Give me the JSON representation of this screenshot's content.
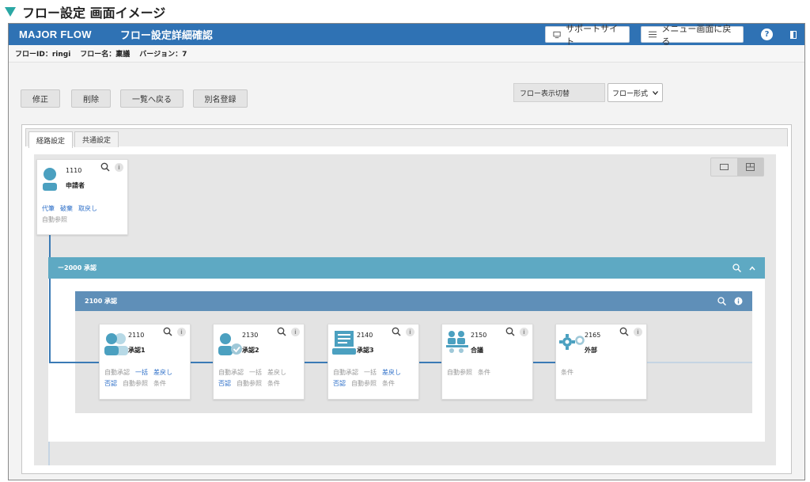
{
  "caption": "フロー設定 画面イメージ",
  "header": {
    "logo": "MAJOR FLOW",
    "title": "フロー設定詳細確認",
    "support_label": "サポートサイト",
    "menu_label": "メニュー画面に戻る"
  },
  "info": {
    "flow_id": "フローID：ringi",
    "flow_name": "フロー名：稟議",
    "version": "バージョン：7"
  },
  "actions": {
    "edit": "修正",
    "delete": "削除",
    "back": "一覧へ戻る",
    "alias": "別名登録",
    "display_switch": "フロー表示切替",
    "display_mode": "フロー形式"
  },
  "tabs": [
    "経路設定",
    "共通設定"
  ],
  "applicant": {
    "num": "1110",
    "name": "申請者",
    "links": [
      "代筆",
      "破棄",
      "取戻し"
    ],
    "sub": "自動参照"
  },
  "group2000": {
    "label": "2000 承認",
    "prefix": "ー"
  },
  "group2100": {
    "label": "2100 承認"
  },
  "nodes": [
    {
      "num": "2110",
      "name": "承認1",
      "row1": [
        "自動承認",
        "一括",
        "差戻し"
      ],
      "row2": [
        "否認",
        "自動参照",
        "条件"
      ]
    },
    {
      "num": "2130",
      "name": "承認2",
      "row1": [
        "自動承認",
        "一括",
        "差戻し"
      ],
      "row2": [
        "否認",
        "自動参照",
        "条件"
      ]
    },
    {
      "num": "2140",
      "name": "承認3",
      "row1": [
        "自動承認",
        "一括",
        "差戻し"
      ],
      "row2": [
        "否認",
        "自動参照",
        "条件"
      ]
    },
    {
      "num": "2150",
      "name": "合議",
      "row1": [
        "自動参照",
        "条件"
      ]
    },
    {
      "num": "2165",
      "name": "外部",
      "row1": [
        "条件"
      ]
    }
  ],
  "colors": {
    "header": "#2f72b4",
    "group2000": "#5ea9c3",
    "group2100": "#5f8fb8",
    "icon": "#4ba0c0",
    "link": "#2d6fc8"
  }
}
